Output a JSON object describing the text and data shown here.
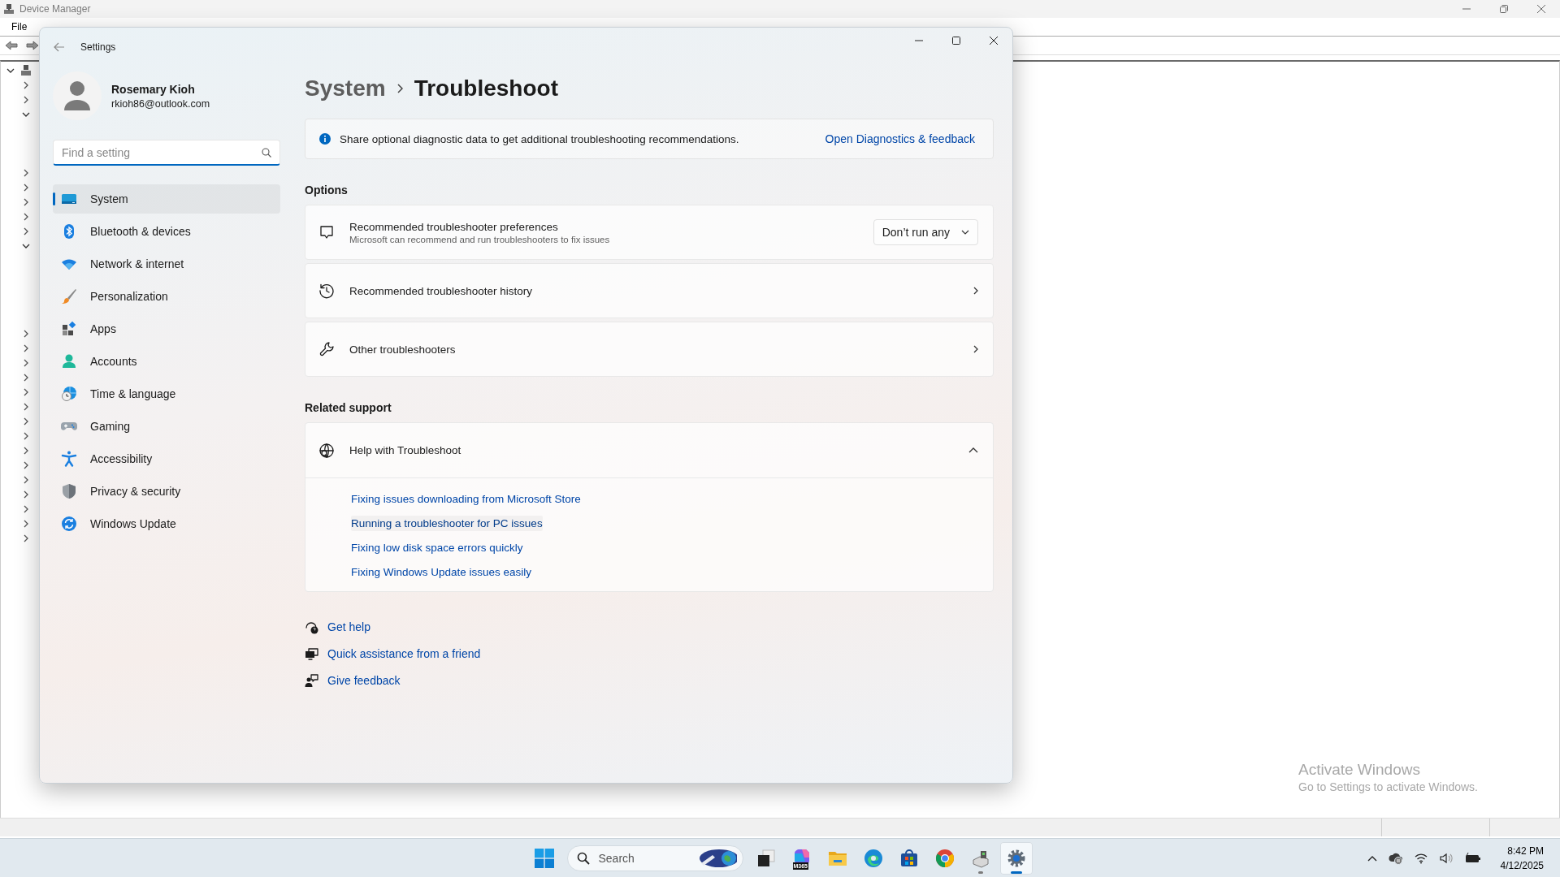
{
  "device_manager": {
    "title": "Device Manager",
    "menu": [
      "File"
    ],
    "tree": [
      {
        "expanded": true
      },
      {
        "expanded": false
      },
      {
        "expanded": false
      },
      {
        "expanded": true
      },
      {
        "expanded": false
      },
      {
        "expanded": false
      },
      {
        "expanded": false
      },
      {
        "expanded": false
      },
      {
        "expanded": false
      },
      {
        "expanded": true
      },
      {
        "expanded": false
      },
      {
        "expanded": false
      },
      {
        "expanded": false
      },
      {
        "expanded": false
      },
      {
        "expanded": false
      },
      {
        "expanded": false
      },
      {
        "expanded": false
      },
      {
        "expanded": false
      },
      {
        "expanded": false
      },
      {
        "expanded": false
      },
      {
        "expanded": false
      },
      {
        "expanded": false
      },
      {
        "expanded": false
      },
      {
        "expanded": false
      },
      {
        "expanded": false
      }
    ]
  },
  "settings": {
    "title": "Settings",
    "user": {
      "name": "Rosemary Kioh",
      "email": "rkioh86@outlook.com"
    },
    "search": {
      "placeholder": "Find a setting"
    },
    "nav": [
      {
        "label": "System",
        "selected": true
      },
      {
        "label": "Bluetooth & devices",
        "selected": false
      },
      {
        "label": "Network & internet",
        "selected": false
      },
      {
        "label": "Personalization",
        "selected": false
      },
      {
        "label": "Apps",
        "selected": false
      },
      {
        "label": "Accounts",
        "selected": false
      },
      {
        "label": "Time & language",
        "selected": false
      },
      {
        "label": "Gaming",
        "selected": false
      },
      {
        "label": "Accessibility",
        "selected": false
      },
      {
        "label": "Privacy & security",
        "selected": false
      },
      {
        "label": "Windows Update",
        "selected": false
      }
    ],
    "breadcrumb": [
      "System",
      "Troubleshoot"
    ],
    "info": {
      "text": "Share optional diagnostic data to get additional troubleshooting recommendations.",
      "link": "Open Diagnostics & feedback"
    },
    "options": {
      "title": "Options",
      "cards": [
        {
          "kind": "dropdown",
          "title": "Recommended troubleshooter preferences",
          "description": "Microsoft can recommend and run troubleshooters to fix issues",
          "value": "Don’t run any"
        },
        {
          "kind": "link",
          "title": "Recommended troubleshooter history"
        },
        {
          "kind": "link",
          "title": "Other troubleshooters"
        }
      ]
    },
    "related_support": {
      "title": "Related support",
      "expander": {
        "title": "Help with Troubleshoot",
        "expanded": true,
        "links": [
          {
            "text": "Fixing issues downloading from Microsoft Store",
            "hovered": false
          },
          {
            "text": "Running a troubleshooter for PC issues",
            "hovered": true
          },
          {
            "text": "Fixing low disk space errors quickly",
            "hovered": false
          },
          {
            "text": "Fixing Windows Update issues easily",
            "hovered": false
          }
        ]
      }
    },
    "footer_links": [
      "Get help",
      "Quick assistance from a friend",
      "Give feedback"
    ]
  },
  "activation": {
    "title": "Activate Windows",
    "subtitle": "Go to Settings to activate Windows."
  },
  "taskbar": {
    "search": {
      "placeholder": "Search"
    },
    "apps": [
      {
        "running": false,
        "active": false
      },
      {
        "running": false,
        "active": false,
        "badge": "M365"
      },
      {
        "running": false,
        "active": false
      },
      {
        "running": false,
        "active": false
      },
      {
        "running": false,
        "active": false
      },
      {
        "running": false,
        "active": false
      },
      {
        "running": true,
        "active": false
      },
      {
        "running": true,
        "active": true
      }
    ],
    "clock": {
      "time": "8:42 PM",
      "date": "4/12/2025"
    }
  }
}
